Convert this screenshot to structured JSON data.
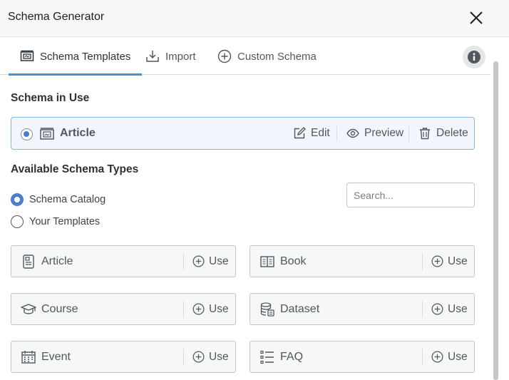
{
  "dialog": {
    "title": "Schema Generator"
  },
  "tabs": [
    {
      "label": "Schema Templates",
      "icon": "template-icon",
      "active": true
    },
    {
      "label": "Import",
      "icon": "import-icon",
      "active": false
    },
    {
      "label": "Custom Schema",
      "icon": "plus-circle-icon",
      "active": false
    }
  ],
  "in_use": {
    "heading": "Schema in Use",
    "schema_name": "Article",
    "actions": {
      "edit": "Edit",
      "preview": "Preview",
      "delete": "Delete"
    }
  },
  "available": {
    "heading": "Available Schema Types",
    "options": [
      {
        "label": "Schema Catalog",
        "selected": true
      },
      {
        "label": "Your Templates",
        "selected": false
      }
    ],
    "search_placeholder": "Search...",
    "use_label": "Use",
    "types": [
      {
        "name": "Article",
        "icon": "article-icon"
      },
      {
        "name": "Book",
        "icon": "book-icon"
      },
      {
        "name": "Course",
        "icon": "graduation-cap-icon"
      },
      {
        "name": "Dataset",
        "icon": "database-icon"
      },
      {
        "name": "Event",
        "icon": "calendar-icon"
      },
      {
        "name": "FAQ",
        "icon": "list-icon"
      }
    ]
  },
  "colors": {
    "accent": "#4a8fd6",
    "radio": "#4b7fc9",
    "in_use_bg": "#f0f6fc",
    "in_use_border": "#8ab4e0"
  }
}
